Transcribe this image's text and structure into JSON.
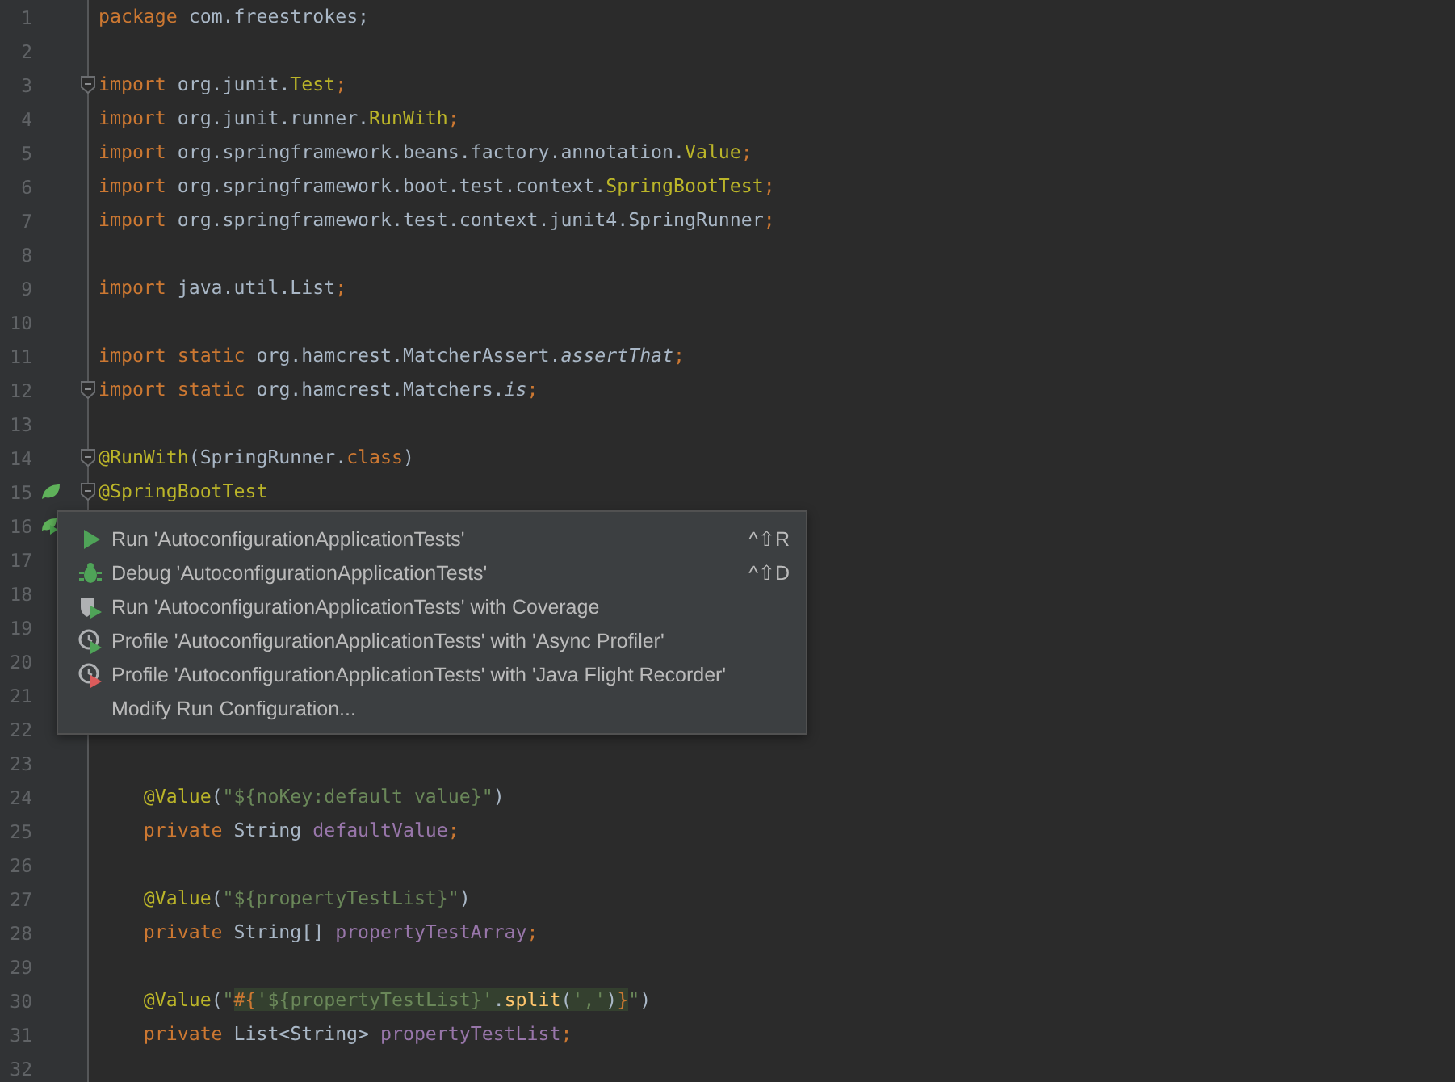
{
  "editor": {
    "lines": [
      {
        "number": "1",
        "kind": "code",
        "tokens": [
          {
            "text": "package",
            "kind": "keyword"
          },
          {
            "text": " com.freestrokes;",
            "kind": "plain"
          }
        ]
      },
      {
        "number": "2",
        "kind": "code"
      },
      {
        "number": "3",
        "kind": "code",
        "fold": true,
        "tokens": [
          {
            "text": "import",
            "kind": "keyword"
          },
          {
            "text": " org.junit.",
            "kind": "plain"
          },
          {
            "text": "Test",
            "kind": "annotation"
          },
          {
            "text": ";",
            "kind": "keyword"
          }
        ]
      },
      {
        "number": "4",
        "kind": "code",
        "tokens": [
          {
            "text": "import",
            "kind": "keyword"
          },
          {
            "text": " org.junit.runner.",
            "kind": "plain"
          },
          {
            "text": "RunWith",
            "kind": "annotation"
          },
          {
            "text": ";",
            "kind": "keyword"
          }
        ]
      },
      {
        "number": "5",
        "kind": "code",
        "tokens": [
          {
            "text": "import",
            "kind": "keyword"
          },
          {
            "text": " org.springframework.beans.factory.annotation.",
            "kind": "plain"
          },
          {
            "text": "Value",
            "kind": "annotation"
          },
          {
            "text": ";",
            "kind": "keyword"
          }
        ]
      },
      {
        "number": "6",
        "kind": "code",
        "tokens": [
          {
            "text": "import",
            "kind": "keyword"
          },
          {
            "text": " org.springframework.boot.test.context.",
            "kind": "plain"
          },
          {
            "text": "SpringBootTest",
            "kind": "annotation"
          },
          {
            "text": ";",
            "kind": "keyword"
          }
        ]
      },
      {
        "number": "7",
        "kind": "code",
        "tokens": [
          {
            "text": "import",
            "kind": "keyword"
          },
          {
            "text": " org.springframework.test.context.junit4.SpringRunner",
            "kind": "plain"
          },
          {
            "text": ";",
            "kind": "keyword"
          }
        ]
      },
      {
        "number": "8",
        "kind": "code"
      },
      {
        "number": "9",
        "kind": "code",
        "tokens": [
          {
            "text": "import",
            "kind": "keyword"
          },
          {
            "text": " java.util.List",
            "kind": "plain"
          },
          {
            "text": ";",
            "kind": "keyword"
          }
        ]
      },
      {
        "number": "10",
        "kind": "code"
      },
      {
        "number": "11",
        "kind": "code",
        "tokens": [
          {
            "text": "import static",
            "kind": "keyword"
          },
          {
            "text": " org.hamcrest.MatcherAssert.",
            "kind": "plain"
          },
          {
            "text": "assertThat",
            "kind": "static"
          },
          {
            "text": ";",
            "kind": "keyword"
          }
        ]
      },
      {
        "number": "12",
        "kind": "code",
        "fold": true,
        "tokens": [
          {
            "text": "import static",
            "kind": "keyword"
          },
          {
            "text": " org.hamcrest.Matchers.",
            "kind": "plain"
          },
          {
            "text": "is",
            "kind": "static"
          },
          {
            "text": ";",
            "kind": "keyword"
          }
        ]
      },
      {
        "number": "13",
        "kind": "code"
      },
      {
        "number": "14",
        "kind": "code",
        "fold": true,
        "tokens": [
          {
            "text": "@RunWith",
            "kind": "annotation"
          },
          {
            "text": "(SpringRunner.",
            "kind": "plain"
          },
          {
            "text": "class",
            "kind": "keyword"
          },
          {
            "text": ")",
            "kind": "plain"
          }
        ]
      },
      {
        "number": "15",
        "kind": "spring",
        "fold": true,
        "tokens": [
          {
            "text": "@SpringBootTest",
            "kind": "annotation"
          }
        ]
      },
      {
        "number": "16",
        "kind": "spring-run"
      },
      {
        "number": "17",
        "kind": "code"
      },
      {
        "number": "18",
        "kind": "code"
      },
      {
        "number": "19",
        "kind": "code"
      },
      {
        "number": "20",
        "kind": "code"
      },
      {
        "number": "21",
        "kind": "code"
      },
      {
        "number": "22",
        "kind": "code"
      },
      {
        "number": "23",
        "kind": "code"
      },
      {
        "number": "24",
        "kind": "code",
        "tokens": [
          {
            "text": "    @Value",
            "kind": "annotation"
          },
          {
            "text": "(",
            "kind": "plain"
          },
          {
            "text": "\"${noKey:default value}\"",
            "kind": "string"
          },
          {
            "text": ")",
            "kind": "plain"
          }
        ]
      },
      {
        "number": "25",
        "kind": "code",
        "tokens": [
          {
            "text": "    private",
            "kind": "keyword"
          },
          {
            "text": " String ",
            "kind": "plain"
          },
          {
            "text": "defaultValue",
            "kind": "field"
          },
          {
            "text": ";",
            "kind": "keyword"
          }
        ]
      },
      {
        "number": "26",
        "kind": "code"
      },
      {
        "number": "27",
        "kind": "code",
        "tokens": [
          {
            "text": "    @Value",
            "kind": "annotation"
          },
          {
            "text": "(",
            "kind": "plain"
          },
          {
            "text": "\"${propertyTestList}\"",
            "kind": "string"
          },
          {
            "text": ")",
            "kind": "plain"
          }
        ]
      },
      {
        "number": "28",
        "kind": "code",
        "tokens": [
          {
            "text": "    private",
            "kind": "keyword"
          },
          {
            "text": " String[] ",
            "kind": "plain"
          },
          {
            "text": "propertyTestArray",
            "kind": "field"
          },
          {
            "text": ";",
            "kind": "keyword"
          }
        ]
      },
      {
        "number": "29",
        "kind": "code"
      },
      {
        "number": "30",
        "kind": "code",
        "tokens": [
          {
            "text": "    @Value",
            "kind": "annotation"
          },
          {
            "text": "(",
            "kind": "plain"
          },
          {
            "text": "\"",
            "kind": "string"
          },
          {
            "text": "#{",
            "kind": "keyword-highlight"
          },
          {
            "text": "'${propertyTestList}'",
            "kind": "string-highlight"
          },
          {
            "text": ".",
            "kind": "plain-highlight"
          },
          {
            "text": "split",
            "kind": "method-highlight"
          },
          {
            "text": "(",
            "kind": "plain-highlight"
          },
          {
            "text": "','",
            "kind": "string-highlight"
          },
          {
            "text": ")",
            "kind": "plain-highlight"
          },
          {
            "text": "}",
            "kind": "keyword-highlight"
          },
          {
            "text": "\"",
            "kind": "string"
          },
          {
            "text": ")",
            "kind": "plain"
          }
        ]
      },
      {
        "number": "31",
        "kind": "code",
        "tokens": [
          {
            "text": "    private",
            "kind": "keyword"
          },
          {
            "text": " List<String> ",
            "kind": "plain"
          },
          {
            "text": "propertyTestList",
            "kind": "field"
          },
          {
            "text": ";",
            "kind": "keyword"
          }
        ]
      },
      {
        "number": "32",
        "kind": "code"
      }
    ]
  },
  "context_menu": {
    "items": [
      {
        "kind": "run",
        "label": "Run 'AutoconfigurationApplicationTests'",
        "shortcut": "^⇧R"
      },
      {
        "kind": "debug",
        "label": "Debug 'AutoconfigurationApplicationTests'",
        "shortcut": "^⇧D"
      },
      {
        "kind": "coverage",
        "label": "Run 'AutoconfigurationApplicationTests' with Coverage"
      },
      {
        "kind": "profile-green",
        "label": "Profile 'AutoconfigurationApplicationTests' with 'Async Profiler'"
      },
      {
        "kind": "profile-red",
        "label": "Profile 'AutoconfigurationApplicationTests' with 'Java Flight Recorder'"
      },
      {
        "kind": "plain",
        "label": "Modify Run Configuration..."
      }
    ]
  }
}
